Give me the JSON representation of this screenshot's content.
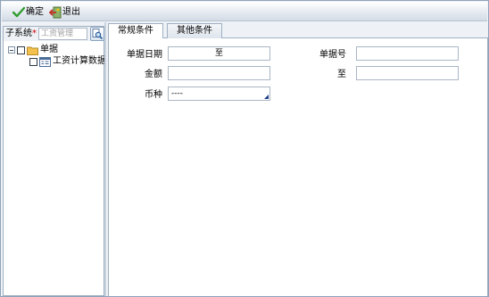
{
  "toolbar": {
    "ok_label": "确定",
    "exit_label": "退出"
  },
  "left_panel": {
    "subsystem_label": "子系统",
    "required_mark": "*",
    "subsystem_value": "工资管理"
  },
  "tree": {
    "root": {
      "label": "单据"
    },
    "child": {
      "label": "工资计算数据"
    }
  },
  "tabs": [
    {
      "label": "常规条件"
    },
    {
      "label": "其他条件"
    }
  ],
  "form": {
    "doc_date_label": "单据日期",
    "doc_date_to": "至",
    "doc_no_label": "单据号",
    "doc_no_value": "",
    "amount_label": "金额",
    "amount_value": "",
    "amount_to_label": "至",
    "amount_to_value": "",
    "currency_label": "币种",
    "currency_value": "----"
  },
  "icons": {
    "ok": "checkmark-icon",
    "exit": "exit-icon",
    "search": "search-icon",
    "folder": "folder-icon",
    "document": "document-icon"
  },
  "colors": {
    "checkmark": "#2e9e2e",
    "folder": "#f2c14e",
    "accent_blue": "#1f3f8a"
  }
}
